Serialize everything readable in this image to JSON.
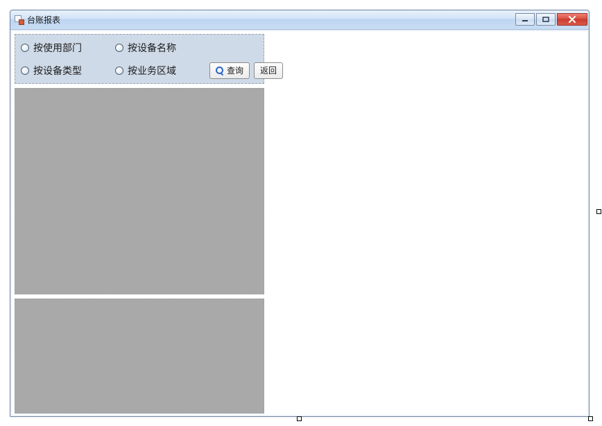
{
  "window": {
    "title": "台账报表"
  },
  "filter": {
    "radios": {
      "by_department": "按使用部门",
      "by_name": "按设备名称",
      "by_type": "按设备类型",
      "by_region": "按业务区域"
    },
    "buttons": {
      "query": "查询",
      "back": "返回"
    }
  }
}
